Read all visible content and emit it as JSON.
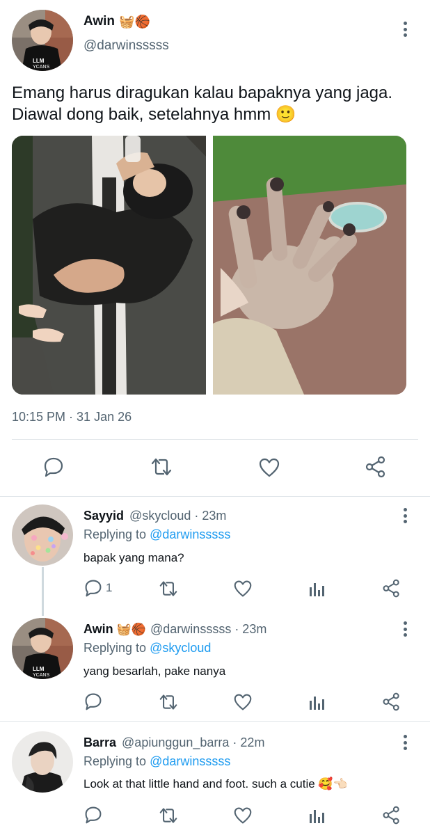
{
  "tweet": {
    "author": {
      "name": "Awin",
      "name_emoji": "🧺🏀",
      "handle": "@darwinsssss"
    },
    "text_line1": "Emang harus diragukan kalau bapaknya yang jaga.",
    "text_line2": "Diawal dong baik, setelahnya hmm",
    "text_emoji": "🙂",
    "timestamp": "10:15 PM · 31 Jan 26",
    "actions": [
      "reply-icon",
      "retweet-icon",
      "like-icon",
      "share-icon"
    ]
  },
  "replies": [
    {
      "name": "Sayyid",
      "name_emoji": "",
      "handle": "@skycloud",
      "time": "· 23m",
      "replying_prefix": "Replying to",
      "replying_to": "@darwinsssss",
      "text": "bapak yang mana?",
      "reply_count": "1"
    },
    {
      "name": "Awin",
      "name_emoji": "🧺🏀",
      "handle": "@darwinsssss",
      "time": "· 23m",
      "replying_prefix": "Replying to",
      "replying_to": "@skycloud",
      "text": "yang besarlah, pake nanya",
      "reply_count": ""
    },
    {
      "name": "Barra",
      "name_emoji": "",
      "handle": "@apiunggun_barra",
      "time": "· 22m",
      "replying_prefix": "Replying to",
      "replying_to": "@darwinsssss",
      "text": "Look at that little hand and foot. such a cutie",
      "text_emoji": "🥰👈🏻",
      "reply_count": ""
    }
  ],
  "colors": {
    "link": "#1d9bf0",
    "muted": "#536471",
    "divider": "#e1e6ea"
  }
}
